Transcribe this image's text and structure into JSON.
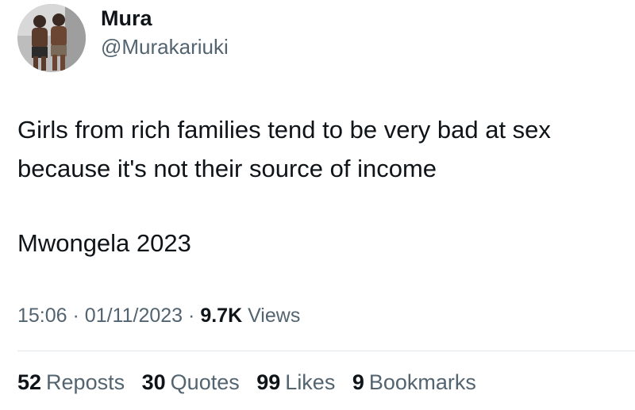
{
  "author": {
    "display_name": "Mura",
    "handle": "@Murakariuki"
  },
  "tweet": {
    "lines": [
      "Girls from rich families tend to be very bad at sex",
      "because it's not their source of income",
      "Mwongela 2023"
    ]
  },
  "meta": {
    "time": "15:06",
    "separator": "·",
    "date": "01/11/2023",
    "views_count": "9.7K",
    "views_label": "Views"
  },
  "stats": [
    {
      "count": "52",
      "label": "Reposts"
    },
    {
      "count": "30",
      "label": "Quotes"
    },
    {
      "count": "99",
      "label": "Likes"
    },
    {
      "count": "9",
      "label": "Bookmarks"
    }
  ]
}
